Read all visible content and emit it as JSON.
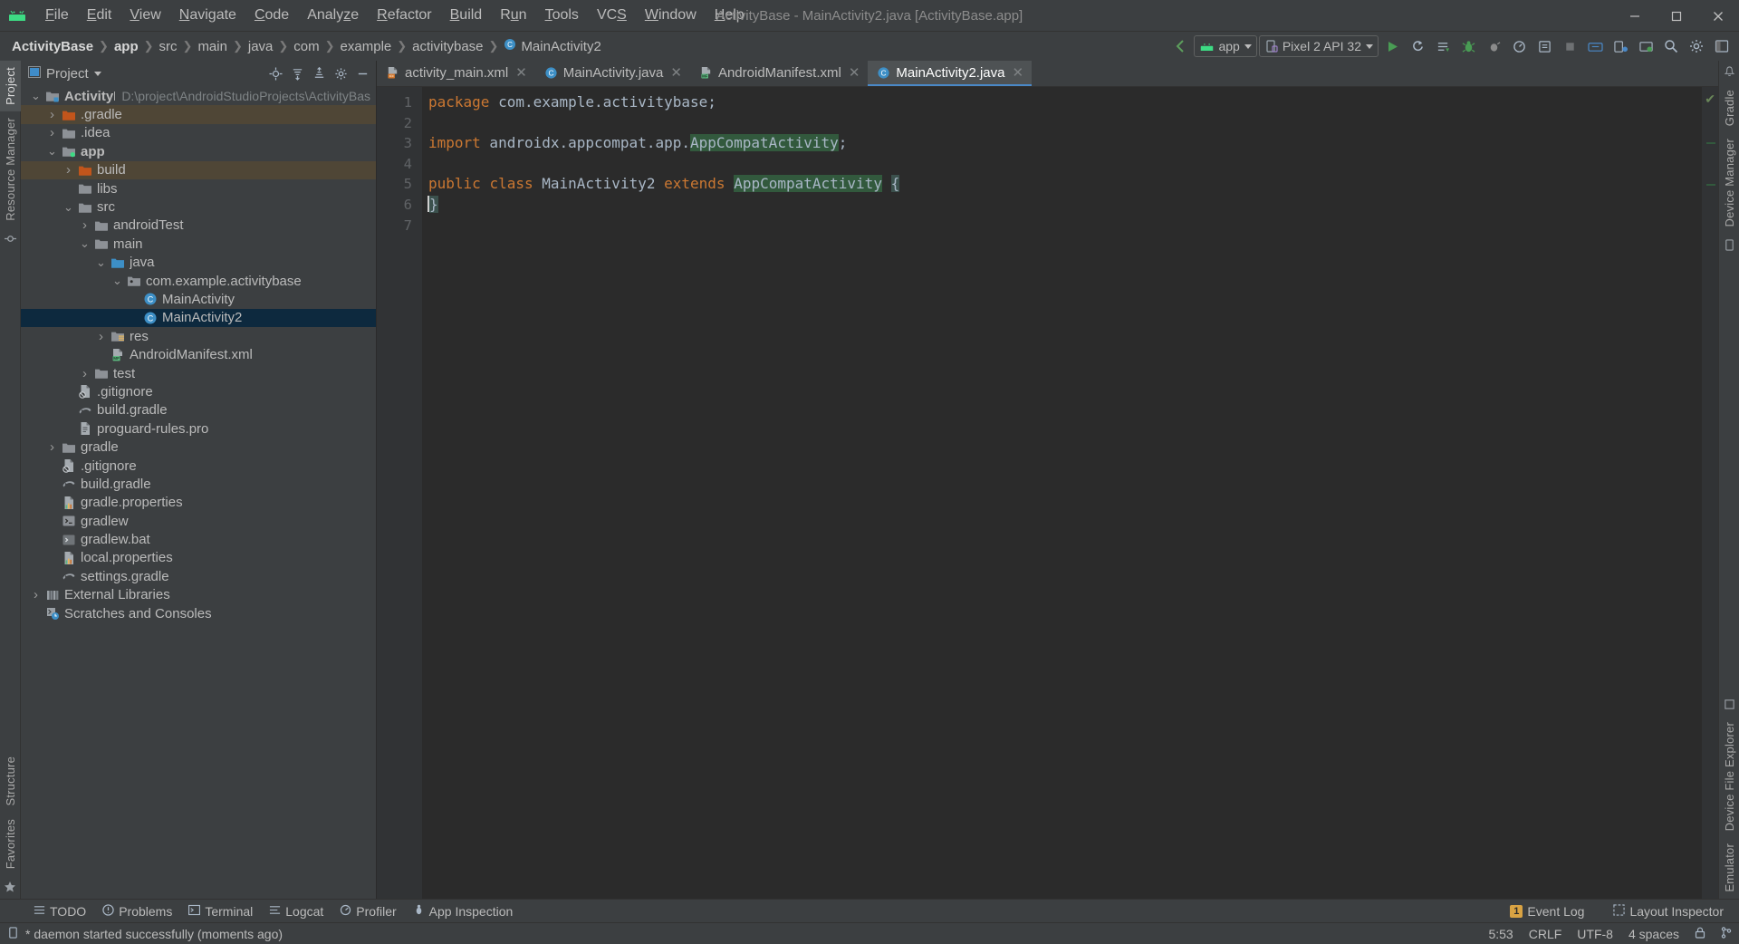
{
  "window": {
    "title": "ActivityBase - MainActivity2.java [ActivityBase.app]",
    "app_icon": "android-logo-icon",
    "minimize": "minimize-icon",
    "maximize": "maximize-icon",
    "close": "close-icon"
  },
  "menu": [
    {
      "label": "File",
      "mnemonic": "F"
    },
    {
      "label": "Edit",
      "mnemonic": "E"
    },
    {
      "label": "View",
      "mnemonic": "V"
    },
    {
      "label": "Navigate",
      "mnemonic": "N"
    },
    {
      "label": "Code",
      "mnemonic": "C"
    },
    {
      "label": "Analyze",
      "mnemonic": "z"
    },
    {
      "label": "Refactor",
      "mnemonic": "R"
    },
    {
      "label": "Build",
      "mnemonic": "B"
    },
    {
      "label": "Run",
      "mnemonic": "u"
    },
    {
      "label": "Tools",
      "mnemonic": "T"
    },
    {
      "label": "VCS",
      "mnemonic": "S"
    },
    {
      "label": "Window",
      "mnemonic": "W"
    },
    {
      "label": "Help",
      "mnemonic": "H"
    }
  ],
  "breadcrumb": [
    {
      "label": "ActivityBase",
      "bold": true
    },
    {
      "label": "app",
      "bold": true
    },
    {
      "label": "src",
      "bold": false
    },
    {
      "label": "main",
      "bold": false
    },
    {
      "label": "java",
      "bold": false
    },
    {
      "label": "com",
      "bold": false
    },
    {
      "label": "example",
      "bold": false
    },
    {
      "label": "activitybase",
      "bold": false
    },
    {
      "label": "MainActivity2",
      "bold": false,
      "icon": "java-class-icon"
    }
  ],
  "toolbar": {
    "module_selector": "app",
    "device_selector": "Pixel 2 API 32",
    "icons": [
      "run-icon",
      "rerun-icon",
      "apply-changes-icon",
      "debug-icon",
      "attach-debugger-icon",
      "profiler-icon",
      "device-manager-icon",
      "stop-icon",
      "sdk-manager-icon",
      "avd-manager-icon",
      "sync-gradle-icon",
      "search-everywhere-icon",
      "settings-icon",
      "project-structure-icon"
    ]
  },
  "left_strip": {
    "tabs": [
      "Project",
      "Resource Manager"
    ],
    "selected": "Project",
    "bottom_tabs": [
      "Structure",
      "Favorites"
    ],
    "bookmark_icon": "star-icon",
    "commit_icon": "commit-icon"
  },
  "right_strip": {
    "tabs": [
      "Gradle",
      "Device Manager",
      "Device File Explorer",
      "Emulator"
    ],
    "notifications_icon": "notifications-icon"
  },
  "project_panel": {
    "title": "Project",
    "title_icon": "project-view-icon",
    "actions": [
      "select-opened-file-icon",
      "expand-all-icon",
      "collapse-all-icon",
      "settings-icon",
      "hide-icon"
    ],
    "tree": [
      {
        "label": "ActivityBase",
        "sub": "D:\\project\\AndroidStudioProjects\\ActivityBas",
        "depth": 0,
        "arrow": "down",
        "icon": "module-icon",
        "bold": true,
        "state": "normal"
      },
      {
        "label": ".gradle",
        "sub": "",
        "depth": 1,
        "arrow": "right",
        "icon": "folder-excluded-icon",
        "bold": false,
        "state": "excluded"
      },
      {
        "label": ".idea",
        "sub": "",
        "depth": 1,
        "arrow": "right",
        "icon": "folder-icon",
        "bold": false,
        "state": "normal"
      },
      {
        "label": "app",
        "sub": "",
        "depth": 1,
        "arrow": "down",
        "icon": "module-android-icon",
        "bold": true,
        "state": "normal"
      },
      {
        "label": "build",
        "sub": "",
        "depth": 2,
        "arrow": "right",
        "icon": "folder-excluded-icon",
        "bold": false,
        "state": "excluded"
      },
      {
        "label": "libs",
        "sub": "",
        "depth": 2,
        "arrow": "none",
        "icon": "folder-icon",
        "bold": false,
        "state": "normal"
      },
      {
        "label": "src",
        "sub": "",
        "depth": 2,
        "arrow": "down",
        "icon": "folder-icon",
        "bold": false,
        "state": "normal"
      },
      {
        "label": "androidTest",
        "sub": "",
        "depth": 3,
        "arrow": "right",
        "icon": "folder-icon",
        "bold": false,
        "state": "normal"
      },
      {
        "label": "main",
        "sub": "",
        "depth": 3,
        "arrow": "down",
        "icon": "folder-icon",
        "bold": false,
        "state": "normal"
      },
      {
        "label": "java",
        "sub": "",
        "depth": 4,
        "arrow": "down",
        "icon": "folder-source-icon",
        "bold": false,
        "state": "normal"
      },
      {
        "label": "com.example.activitybase",
        "sub": "",
        "depth": 5,
        "arrow": "down",
        "icon": "package-icon",
        "bold": false,
        "state": "normal"
      },
      {
        "label": "MainActivity",
        "sub": "",
        "depth": 6,
        "arrow": "none",
        "icon": "java-class-icon",
        "bold": false,
        "state": "normal"
      },
      {
        "label": "MainActivity2",
        "sub": "",
        "depth": 6,
        "arrow": "none",
        "icon": "java-class-icon",
        "bold": false,
        "state": "selected"
      },
      {
        "label": "res",
        "sub": "",
        "depth": 4,
        "arrow": "right",
        "icon": "folder-res-icon",
        "bold": false,
        "state": "normal"
      },
      {
        "label": "AndroidManifest.xml",
        "sub": "",
        "depth": 4,
        "arrow": "none",
        "icon": "manifest-icon",
        "bold": false,
        "state": "normal"
      },
      {
        "label": "test",
        "sub": "",
        "depth": 3,
        "arrow": "right",
        "icon": "folder-icon",
        "bold": false,
        "state": "normal"
      },
      {
        "label": ".gitignore",
        "sub": "",
        "depth": 2,
        "arrow": "none",
        "icon": "gitignore-icon",
        "bold": false,
        "state": "normal"
      },
      {
        "label": "build.gradle",
        "sub": "",
        "depth": 2,
        "arrow": "none",
        "icon": "gradle-icon",
        "bold": false,
        "state": "normal"
      },
      {
        "label": "proguard-rules.pro",
        "sub": "",
        "depth": 2,
        "arrow": "none",
        "icon": "file-icon",
        "bold": false,
        "state": "normal"
      },
      {
        "label": "gradle",
        "sub": "",
        "depth": 1,
        "arrow": "right",
        "icon": "folder-icon",
        "bold": false,
        "state": "normal"
      },
      {
        "label": ".gitignore",
        "sub": "",
        "depth": 1,
        "arrow": "none",
        "icon": "gitignore-icon",
        "bold": false,
        "state": "normal"
      },
      {
        "label": "build.gradle",
        "sub": "",
        "depth": 1,
        "arrow": "none",
        "icon": "gradle-icon",
        "bold": false,
        "state": "normal"
      },
      {
        "label": "gradle.properties",
        "sub": "",
        "depth": 1,
        "arrow": "none",
        "icon": "properties-icon",
        "bold": false,
        "state": "normal"
      },
      {
        "label": "gradlew",
        "sub": "",
        "depth": 1,
        "arrow": "none",
        "icon": "shell-script-icon",
        "bold": false,
        "state": "normal"
      },
      {
        "label": "gradlew.bat",
        "sub": "",
        "depth": 1,
        "arrow": "none",
        "icon": "bat-file-icon",
        "bold": false,
        "state": "normal"
      },
      {
        "label": "local.properties",
        "sub": "",
        "depth": 1,
        "arrow": "none",
        "icon": "properties-icon",
        "bold": false,
        "state": "normal"
      },
      {
        "label": "settings.gradle",
        "sub": "",
        "depth": 1,
        "arrow": "none",
        "icon": "gradle-icon",
        "bold": false,
        "state": "normal"
      },
      {
        "label": "External Libraries",
        "sub": "",
        "depth": 0,
        "arrow": "right",
        "icon": "libraries-icon",
        "bold": false,
        "state": "normal"
      },
      {
        "label": "Scratches and Consoles",
        "sub": "",
        "depth": 0,
        "arrow": "none",
        "icon": "scratches-icon",
        "bold": false,
        "state": "normal"
      }
    ]
  },
  "editor": {
    "tabs": [
      {
        "label": "activity_main.xml",
        "icon": "xml-layout-icon",
        "active": false,
        "closable": true
      },
      {
        "label": "MainActivity.java",
        "icon": "java-class-icon",
        "active": false,
        "closable": true
      },
      {
        "label": "AndroidManifest.xml",
        "icon": "manifest-icon",
        "active": false,
        "closable": true
      },
      {
        "label": "MainActivity2.java",
        "icon": "java-class-icon",
        "active": true,
        "closable": true
      }
    ],
    "line_numbers": [
      "1",
      "2",
      "3",
      "4",
      "5",
      "6",
      "7"
    ],
    "lines": [
      {
        "n": 1,
        "tokens": [
          {
            "t": "package",
            "c": "kw"
          },
          {
            "t": " com.example.activitybase;",
            "c": "plain"
          }
        ]
      },
      {
        "n": 2,
        "tokens": []
      },
      {
        "n": 3,
        "tokens": [
          {
            "t": "import",
            "c": "kw"
          },
          {
            "t": " androidx.appcompat.app.",
            "c": "plain"
          },
          {
            "t": "AppCompatActivity",
            "c": "hl"
          },
          {
            "t": ";",
            "c": "plain"
          }
        ]
      },
      {
        "n": 4,
        "tokens": []
      },
      {
        "n": 5,
        "tokens": [
          {
            "t": "public",
            "c": "kw"
          },
          {
            "t": " ",
            "c": "plain"
          },
          {
            "t": "class",
            "c": "kw"
          },
          {
            "t": " MainActivity2 ",
            "c": "plain"
          },
          {
            "t": "extends",
            "c": "kw"
          },
          {
            "t": " ",
            "c": "plain"
          },
          {
            "t": "AppCompatActivity",
            "c": "hl"
          },
          {
            "t": " ",
            "c": "plain"
          },
          {
            "t": "{",
            "c": "brace"
          }
        ]
      },
      {
        "n": 6,
        "tokens": [
          {
            "t": "}",
            "c": "brace"
          }
        ]
      },
      {
        "n": 7,
        "tokens": []
      }
    ],
    "inspection_status": "no-problems-check-icon"
  },
  "tool_windows": [
    {
      "label": "TODO",
      "icon": "todo-icon"
    },
    {
      "label": "Problems",
      "icon": "problems-icon"
    },
    {
      "label": "Terminal",
      "icon": "terminal-icon"
    },
    {
      "label": "Logcat",
      "icon": "logcat-icon"
    },
    {
      "label": "Profiler",
      "icon": "profiler-icon"
    },
    {
      "label": "App Inspection",
      "icon": "app-inspection-icon"
    }
  ],
  "tool_windows_right": [
    {
      "label": "Event Log",
      "icon": "event-log-icon",
      "count": "1"
    },
    {
      "label": "Layout Inspector",
      "icon": "layout-inspector-icon",
      "count": ""
    }
  ],
  "status_bar": {
    "message": "* daemon started successfully (moments ago)",
    "message_icon": "memory-icon",
    "position": "5:53",
    "line_separator": "CRLF",
    "encoding": "UTF-8",
    "indent": "4 spaces",
    "lock_icon": "read-only-lock-icon",
    "branch_icon": "git-branch-icon"
  },
  "colors": {
    "accent_blue": "#4a88c7",
    "selection_blue": "#0d293e",
    "excluded_brown": "#4f4636",
    "keyword_orange": "#cc7832",
    "highlight_green": "#32593d",
    "android_green": "#3ddc84",
    "panel_bg": "#3c3f41",
    "editor_bg": "#2b2b2b",
    "gutter_bg": "#313335",
    "text": "#bbbbbb"
  }
}
